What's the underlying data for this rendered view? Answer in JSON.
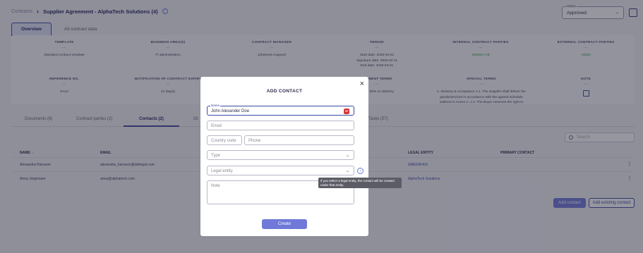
{
  "breadcrumb": {
    "root": "Contracts",
    "separator": "›",
    "title": "Supplier Agreement - AlphaTech Solutions (4)"
  },
  "status": {
    "label": "Status",
    "value": "Approved"
  },
  "top_tabs": [
    "Overview",
    "All contract data"
  ],
  "overview": {
    "row1": [
      {
        "header": "TEMPLATE",
        "dash": "—",
        "value": "Standard contract template"
      },
      {
        "header": "BUSINESS AREA(S)",
        "dash": "—",
        "value": "IT administration"
      },
      {
        "header": "CONTRACT MANAGER",
        "dash": "—",
        "value": "Johannes Augusrd"
      },
      {
        "header": "PERIOD",
        "dash": "—",
        "lines": [
          "Start date: 2025-03-01",
          "Signature date: 2025-02-11",
          "End date: 2028-03-01"
        ]
      },
      {
        "header": "INTERNAL CONTRACT PARTIES",
        "dash": "—",
        "value": "SMEDIA AB"
      },
      {
        "header": "EXTERNAL CONTRACT PARTIES",
        "dash": "—",
        "value": "Adobe"
      }
    ],
    "row2": [
      {
        "header": "REFERENCE NO.",
        "dash": "—",
        "value": "SA12"
      },
      {
        "header": "NOTIFICATION OF CONTRACT EXPIRY",
        "dash": "—",
        "value": "21 day(s)"
      },
      {
        "header": "PAYMENT TERMS",
        "dash": "—",
        "value": "ment, 50% on delivery"
      },
      {
        "header": "SPECIAL TERMS",
        "dash": "—",
        "lines": [
          "1. Delivery & Acceptance 1.1. The Supplier shall deliver the",
          "goods/services in accordance with the agreed schedule",
          "outlined in Annex A. 1.2. The Buyer reserves the right to"
        ]
      },
      {
        "header": "NOTE",
        "dash": "—"
      }
    ]
  },
  "mid_tabs": [
    "Documents (6)",
    "Contract parties (2)",
    "Contacts (2)",
    "Ot",
    "Tasks (57)"
  ],
  "search": {
    "placeholder": "Search"
  },
  "table": {
    "headers": [
      "NAME ↑",
      "EMAIL",
      "LEGAL ENTITY",
      "PRIMARY CONTACT"
    ],
    "rows": [
      {
        "name": "Alexandra Hansson",
        "email": "alexandra_hansson@idelegal.com",
        "entity": "SMEDIA A/S",
        "menu": "⋮"
      },
      {
        "name": "Anna Jorgensen",
        "email": "anna@alphatech.com",
        "entity": "AlphaTech Solutions",
        "menu": "⋮"
      }
    ]
  },
  "buttons": {
    "add_contact": "Add contact",
    "add_existing": "Add existing contact"
  },
  "modal": {
    "title": "ADD CONTACT",
    "close": "×",
    "name_label": "Name",
    "name_value": "John Alexander Doe",
    "email_placeholder": "Email",
    "country_placeholder": "Country code",
    "phone_placeholder": "Phone",
    "type_placeholder": "Type",
    "legal_entity_placeholder": "Legal entity",
    "note_placeholder": "Note",
    "tooltip": "If you select a legal entity, the contact will be created under that entity.",
    "create": "Create"
  }
}
